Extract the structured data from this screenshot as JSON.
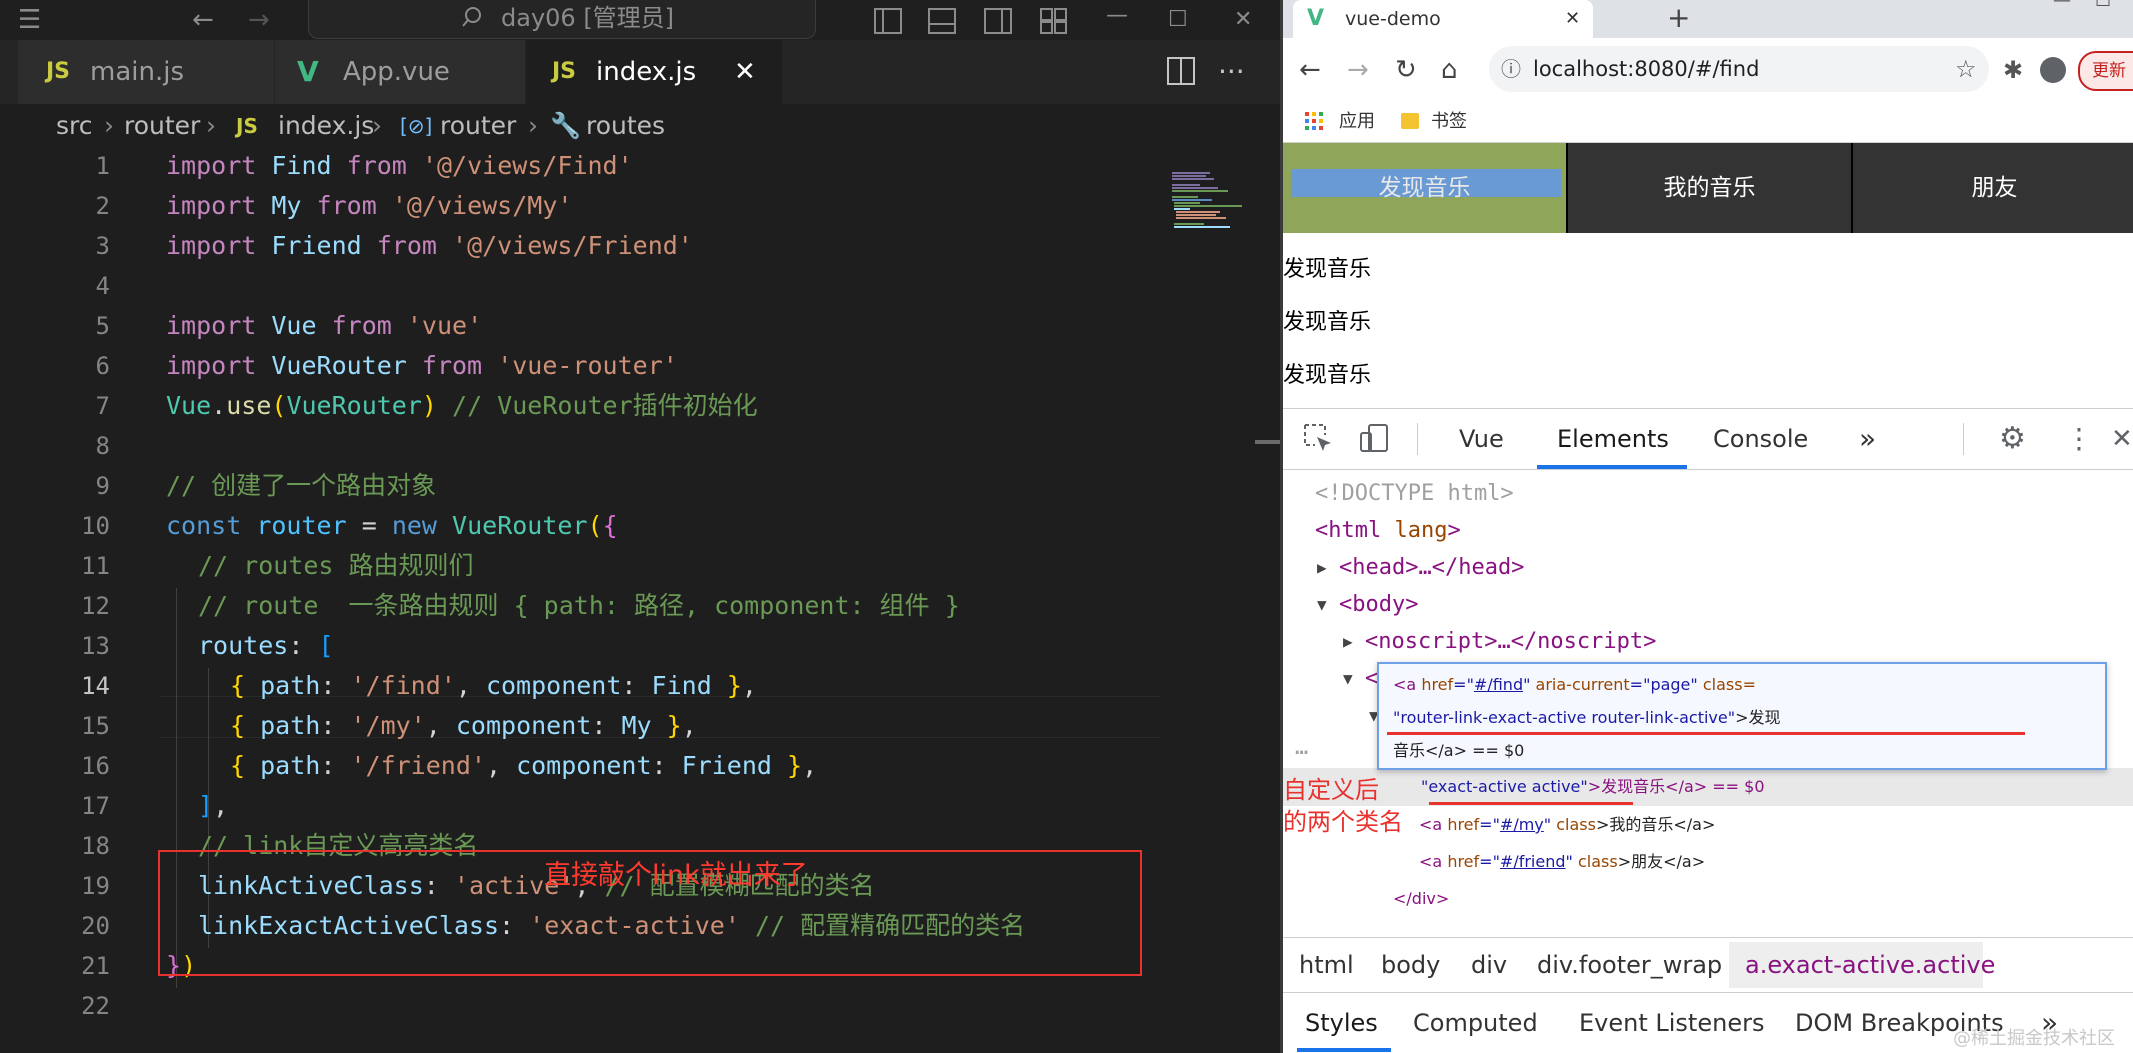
{
  "vscode": {
    "title": "day06 [管理员]",
    "tabs": [
      {
        "badge": "JS",
        "label": "main.js"
      },
      {
        "badge": "V",
        "label": "App.vue"
      },
      {
        "badge": "JS",
        "label": "index.js",
        "close": "✕"
      }
    ],
    "breadcrumb": {
      "p1": "src",
      "p2": "router",
      "p3_badge": "JS",
      "p3": "index.js",
      "p4": "router",
      "p5": "routes"
    },
    "line_numbers": [
      "1",
      "2",
      "3",
      "4",
      "5",
      "6",
      "7",
      "8",
      "9",
      "10",
      "11",
      "12",
      "13",
      "14",
      "15",
      "16",
      "17",
      "18",
      "19",
      "20",
      "21",
      "22"
    ],
    "current_line": "14",
    "code": {
      "l1": [
        "import",
        "Find",
        "from",
        "'@/views/Find'"
      ],
      "l2": [
        "import",
        "My",
        "from",
        "'@/views/My'"
      ],
      "l3": [
        "import",
        "Friend",
        "from",
        "'@/views/Friend'"
      ],
      "l5": [
        "import",
        "Vue",
        "from",
        "'vue'"
      ],
      "l6": [
        "import",
        "VueRouter",
        "from",
        "'vue-router'"
      ],
      "l7": [
        "Vue",
        ".",
        "use",
        "(",
        "VueRouter",
        ")",
        "// VueRouter插件初始化"
      ],
      "l9": "// 创建了一个路由对象",
      "l10": [
        "const",
        "router",
        "=",
        "new",
        "VueRouter",
        "(",
        "{"
      ],
      "l11": "// routes 路由规则们",
      "l12": "// route  一条路由规则 { path: 路径, component: 组件 }",
      "l13": [
        "routes",
        ":",
        "["
      ],
      "l14": [
        "{",
        "path",
        ":",
        "'/find'",
        ",",
        "component",
        ":",
        "Find",
        "}",
        ","
      ],
      "l15": [
        "{",
        "path",
        ":",
        "'/my'",
        ",",
        "component",
        ":",
        "My",
        "}",
        ","
      ],
      "l16": [
        "{",
        "path",
        ":",
        "'/friend'",
        ",",
        "component",
        ":",
        "Friend",
        "}",
        ","
      ],
      "l17": [
        "]",
        ","
      ],
      "l18": "// link自定义高亮类名",
      "l19": [
        "linkActiveClass",
        ":",
        "'active'",
        ",",
        "// 配置模糊匹配的类名"
      ],
      "l20": [
        "linkExactActiveClass",
        ":",
        "'exact-active'",
        "// 配置精确匹配的类名"
      ],
      "l21": [
        "}",
        ")"
      ]
    },
    "annotation": "直接敲个link就出来了"
  },
  "chrome": {
    "tab_title": "vue-demo",
    "tab_close": "✕",
    "new_tab": "+",
    "url": "localhost:8080/#/find",
    "update_label": "更新",
    "bookmarks": {
      "apps": "应用",
      "folder": "书签"
    },
    "nav_buttons": [
      "发现音乐",
      "我的音乐",
      "朋友"
    ],
    "page_lines": [
      "发现音乐",
      "发现音乐",
      "发现音乐"
    ],
    "devtools": {
      "tabs": [
        "Vue",
        "Elements",
        "Console",
        "»"
      ],
      "active_tab": "Elements",
      "dom": {
        "doctype": "<!DOCTYPE html>",
        "html_open": [
          "<html",
          "lang",
          ">"
        ],
        "head": "<head>…</head>",
        "body": "<body>",
        "noscript": "<noscript>…</noscript>",
        "div_lt": "<",
        "hl_val": "exact-active active",
        "hl_rest": ">发现音乐</a> == $0",
        "my_line": [
          "<a",
          "href",
          "=\"",
          "#/my",
          "\"",
          "class",
          ">我的音乐</a>"
        ],
        "friend_line": [
          "<a",
          "href",
          "=\"",
          "#/friend",
          "\"",
          "class",
          ">朋友</a>"
        ],
        "div_close": "</div>",
        "ellipsis": "…"
      },
      "popup": {
        "l1": [
          "<a",
          "href",
          "#/find",
          "aria-current",
          "page",
          "class="
        ],
        "l2_val": "router-link-exact-active router-link-active",
        "l2_rest": ">发现",
        "l3": "音乐</a> == $0"
      },
      "left_note": [
        "自定义后",
        "的两个类名"
      ],
      "crumbs": [
        "html",
        "body",
        "div",
        "div.footer_wrap",
        "a.exact-active.active"
      ],
      "subtabs": [
        "Styles",
        "Computed",
        "Event Listeners",
        "DOM Breakpoints",
        "»"
      ]
    }
  },
  "watermark": "@稀土掘金技术社区"
}
